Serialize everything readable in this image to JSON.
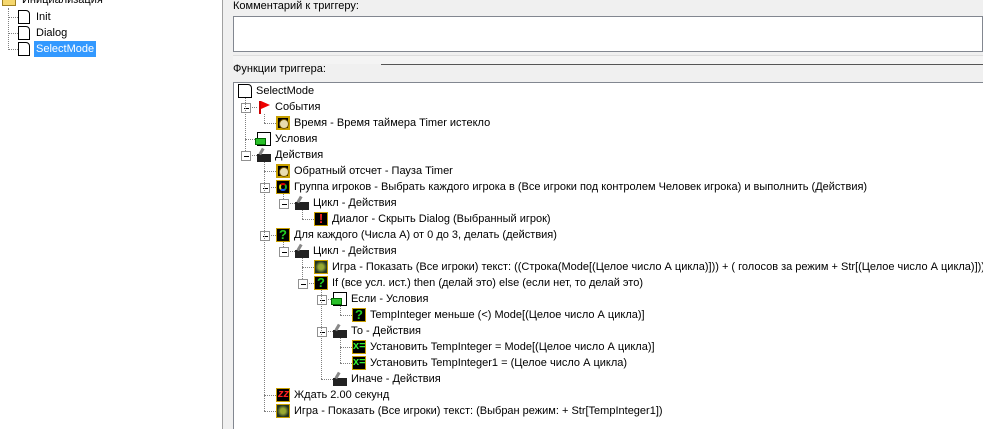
{
  "left_tree": {
    "folder": "Инициализация",
    "items": [
      {
        "label": "Init",
        "selected": false
      },
      {
        "label": "Dialog",
        "selected": false
      },
      {
        "label": "SelectMode",
        "selected": true
      }
    ]
  },
  "comment": {
    "label": "Комментарий к триггеру:",
    "value": ""
  },
  "functions": {
    "label": "Функции триггера:",
    "rows": [
      {
        "level": 0,
        "expander": false,
        "icon": "doc-icon",
        "text": "SelectMode"
      },
      {
        "level": 1,
        "expander": true,
        "icon": "flag-icon",
        "text": "События"
      },
      {
        "level": 2,
        "expander": false,
        "icon": "clock-icon",
        "text": "Время - Время таймера Timer истекло"
      },
      {
        "level": 1,
        "expander": false,
        "icon": "condition-icon",
        "text": "Условия"
      },
      {
        "level": 1,
        "expander": true,
        "icon": "action-icon",
        "text": "Действия"
      },
      {
        "level": 2,
        "expander": false,
        "icon": "clock-icon",
        "text": "Обратный отсчет - Пауза Timer"
      },
      {
        "level": 2,
        "expander": true,
        "icon": "players-icon",
        "text": "Группа игроков - Выбрать каждого игрока в (Все игроки под контролем Человек игрока) и выполнить (Действия)"
      },
      {
        "level": 3,
        "expander": true,
        "icon": "action-icon",
        "text": "Цикл - Действия"
      },
      {
        "level": 4,
        "expander": false,
        "icon": "alert-icon",
        "text": "Диалог - Скрыть Dialog (Выбранный игрок)"
      },
      {
        "level": 2,
        "expander": true,
        "icon": "question-icon",
        "text": "Для каждого (Числа А) от 0 до 3, делать (действия)"
      },
      {
        "level": 3,
        "expander": true,
        "icon": "action-icon",
        "text": "Цикл - Действия"
      },
      {
        "level": 4,
        "expander": false,
        "icon": "game-icon",
        "text": "Игра - Показать (Все игроки) текст: ((Строка(Mode[(Целое число А цикла)])) + ( голосов за режим  + Str[(Целое число А цикла)]))"
      },
      {
        "level": 4,
        "expander": true,
        "icon": "question-icon",
        "text": "If (все усл. ист.) then (делай это) else (если нет, то делай это)"
      },
      {
        "level": 5,
        "expander": true,
        "icon": "condition-icon",
        "text": "Если - Условия"
      },
      {
        "level": 6,
        "expander": false,
        "icon": "question-icon",
        "text": "TempInteger меньше (<) Mode[(Целое число А цикла)]"
      },
      {
        "level": 5,
        "expander": true,
        "icon": "action-icon",
        "text": "То - Действия"
      },
      {
        "level": 6,
        "expander": false,
        "icon": "set-variable-icon",
        "text": "Установить TempInteger = Mode[(Целое число А цикла)]"
      },
      {
        "level": 6,
        "expander": false,
        "icon": "set-variable-icon",
        "text": "Установить TempInteger1 = (Целое число А цикла)"
      },
      {
        "level": 5,
        "expander": false,
        "icon": "action-icon",
        "text": "Иначе - Действия"
      },
      {
        "level": 2,
        "expander": false,
        "icon": "wait-icon",
        "text": "Ждать 2.00 секунд"
      },
      {
        "level": 2,
        "expander": false,
        "icon": "game-icon",
        "text": "Игра - Показать (Все игроки) текст: (Выбран режим:  + Str[TempInteger1])"
      }
    ]
  }
}
